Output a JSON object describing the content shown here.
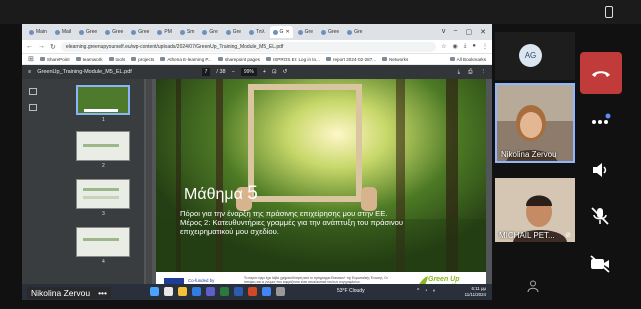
{
  "browser": {
    "tabs": [
      {
        "label": "Main"
      },
      {
        "label": "Mail"
      },
      {
        "label": "Gree"
      },
      {
        "label": "Gree"
      },
      {
        "label": "Gree"
      },
      {
        "label": "PM"
      },
      {
        "label": "Sm"
      },
      {
        "label": "Gre"
      },
      {
        "label": "Gre"
      },
      {
        "label": "Τιτλ"
      },
      {
        "label": "G"
      },
      {
        "label": "Gre"
      },
      {
        "label": "Gree"
      },
      {
        "label": "Gre"
      }
    ],
    "window_controls": [
      "v",
      "−",
      "▢",
      "✕"
    ],
    "url": "elearning.greenupyourself.eu/wp-content/uploads/2024/07/GreenUp_Training_Module_M5_EL.pdf",
    "bookmarks": [
      "SharePoint",
      "teamwork",
      "tools",
      "projects",
      "Athena E-learning P...",
      "sharepoint pages",
      "ISPROS.EI: Log in to...",
      "report 2024-02-287...",
      "Networks"
    ],
    "bookmarks_last": "All Bookmarks"
  },
  "pdf": {
    "filename": "GreenUp_Training-Module_M5_EL.pdf",
    "page_current": "7",
    "page_total": "/ 38",
    "zoom": "99%",
    "thumb_numbers": [
      "1",
      "2",
      "3",
      "4"
    ]
  },
  "slide": {
    "title_word": "Μάθημα",
    "title_num": "5",
    "subtitle_line1": "Πόροι για την έναρξη της πράσινης επιχείρησης μου στην ΕΕ.",
    "subtitle_line2": "Μέρος 2: Κατευθυντήριες γραμμές για την ανάπτυξη του πράσινου",
    "subtitle_line3": "επιχειρηματικού μου σχεδίου.",
    "eu_line1": "Co-funded by",
    "eu_line2": "the European Union",
    "disclaimer": "Το παρόν έργο έχει λάβει χρηματοδότηση από το πρόγραμμα Erasmus+ της Ευρωπαϊκής Ένωσης. Οι απόψεις και οι γνώμες που εκφράζονται είναι αποκλειστικά του/των συγγραφέα/ων.",
    "logo_line1": "Green Up",
    "logo_line2": "yourself"
  },
  "taskbar": {
    "weather": "53°F Cloudy",
    "time": "6:11 μμ",
    "date": "11/11/2024"
  },
  "presenter_name": "Nikolina Zervou",
  "presenter_menu": "•••",
  "participants": {
    "ag_initials": "AG",
    "tile1_name": "Nikolina Zervou",
    "tile2_name": "MICHAIL PET..."
  },
  "colors": {
    "hangup": "#c23b3b",
    "selected_border": "#8fb7ff",
    "logo_green": "#8bb620"
  },
  "icons": [
    "phone-hangup-icon",
    "more-icon",
    "speaker-icon",
    "mic-off-icon",
    "camera-off-icon",
    "people-icon"
  ]
}
